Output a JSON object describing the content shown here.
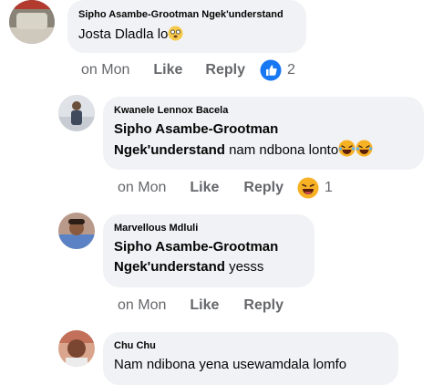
{
  "comments": [
    {
      "author": "Sipho Asambe-Grootman Ngek'understand",
      "text": "Josta Dladla lo",
      "time": "on Mon",
      "like": "Like",
      "reply": "Reply",
      "reaction_count": "2",
      "reaction_icon": "like-icon"
    },
    {
      "author": "Kwanele Lennox Bacela",
      "tag_line1": "Sipho Asambe-Grootman",
      "tag_line2": "Ngek'understand",
      "text": " nam ndbona lonto",
      "time": "on Mon",
      "like": "Like",
      "reply": "Reply",
      "reaction_count": "1",
      "reaction_icon": "haha-icon"
    },
    {
      "author": "Marvellous Mdluli",
      "tag_line1": "Sipho Asambe-Grootman",
      "tag_line2": "Ngek'understand",
      "text": " yesss",
      "time": "on Mon",
      "like": "Like",
      "reply": "Reply"
    },
    {
      "author": "Chu Chu",
      "text": "Nam ndibona yena usewamdala lomfo"
    }
  ],
  "colors": {
    "bubble": "#f0f2f5",
    "meta": "#65676b",
    "like_blue": "#1877f2",
    "haha_yellow": "#f7b125"
  }
}
